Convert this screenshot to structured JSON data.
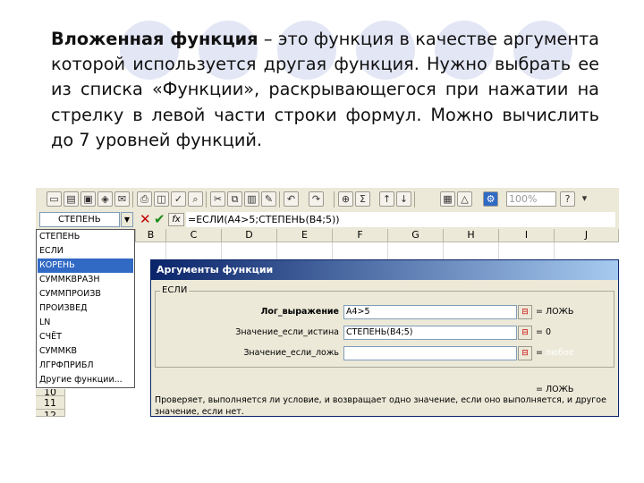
{
  "slide": {
    "term": "Вложенная функция",
    "body": " – это функция в качестве аргумента которой используется другая функция. Нужно выбрать ее из списка «Функции», раскрывающегося при нажатии на стрелку в левой части строки формул. Можно вычислить до 7 уровней функций.",
    "accent_color": "#e3e6f5"
  },
  "toolbar": {
    "zoom": "100%",
    "icons": [
      "new-icon",
      "open-icon",
      "save-icon",
      "permission-icon",
      "email-icon",
      "print-icon",
      "print-preview-icon",
      "spelling-icon",
      "research-icon",
      "cut-icon",
      "copy-icon",
      "paste-icon",
      "format-painter-icon",
      "undo-icon",
      "redo-icon",
      "hyperlink-icon",
      "autosum-icon",
      "sort-asc-icon",
      "sort-desc-icon",
      "chart-wizard-icon",
      "drawing-icon",
      "zoom-icon",
      "help-icon"
    ]
  },
  "formula_bar": {
    "name_box": "СТЕПЕНЬ",
    "cancel_symbol": "✕",
    "enter_symbol": "✔",
    "fx": "fx",
    "formula": "=ЕСЛИ(A4>5;СТЕПЕНЬ(B4;5))"
  },
  "columns": [
    "B",
    "C",
    "D",
    "E",
    "F",
    "G",
    "H",
    "I",
    "J"
  ],
  "rows": [
    "10",
    "11",
    "12"
  ],
  "function_list": {
    "items": [
      "СТЕПЕНЬ",
      "ЕСЛИ",
      "КОРЕНЬ",
      "СУММКВРАЗН",
      "СУММПРОИЗВ",
      "ПРОИЗВЕД",
      "LN",
      "СЧЁТ",
      "СУММКВ",
      "ЛГРФПРИБЛ",
      "Другие функции..."
    ],
    "selected_index": 2
  },
  "dialog": {
    "title": "Аргументы функции",
    "group_label": "ЕСЛИ",
    "args": [
      {
        "label": "Лог_выражение",
        "value": "A4>5",
        "result": "= ЛОЖЬ",
        "bold": true
      },
      {
        "label": "Значение_если_истина",
        "value": "СТЕПЕНЬ(B4;5)",
        "result": "= 0",
        "bold": false
      },
      {
        "label": "Значение_если_ложь",
        "value": "",
        "result": "= ",
        "result_dim": "любое",
        "bold": false
      }
    ],
    "result": "= ЛОЖЬ",
    "description": "Проверяет, выполняется ли условие, и возвращает одно значение, если оно выполняется, и другое значение, если нет."
  }
}
